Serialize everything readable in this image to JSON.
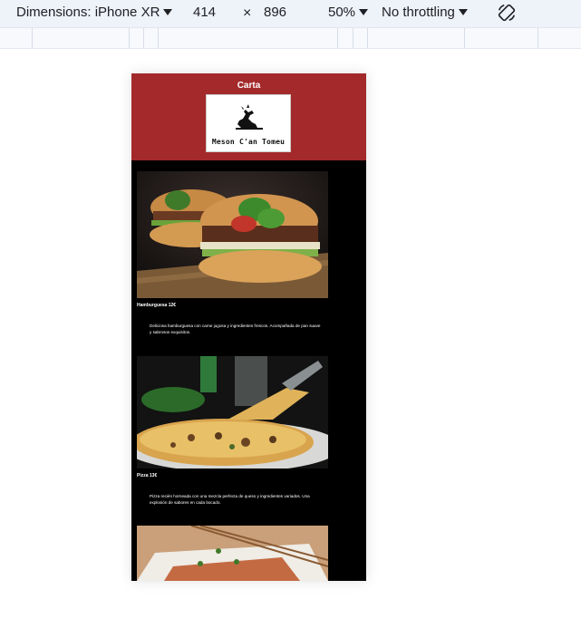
{
  "devtools": {
    "dimensions_label": "Dimensions: iPhone XR",
    "width": "414",
    "times": "×",
    "height": "896",
    "zoom": "50%",
    "throttling": "No throttling",
    "rotate_icon": "rotate-icon"
  },
  "page": {
    "header_title": "Carta",
    "logo_text": "Meson C'an Tomeu",
    "brand_color": "#a3292b",
    "items": [
      {
        "title": "Hamburguesa 12€",
        "desc": "Deliciosa hamburguesa con carne jugosa y ingredientes frescos. Acompañada de pan suave y sabrosos exquisitos."
      },
      {
        "title": "Pizza 13€",
        "desc": "Pizza recién horneada con una mezcla perfecta de queso y ingredientes variados. Una explosión de sabores en cada bocado."
      }
    ]
  }
}
